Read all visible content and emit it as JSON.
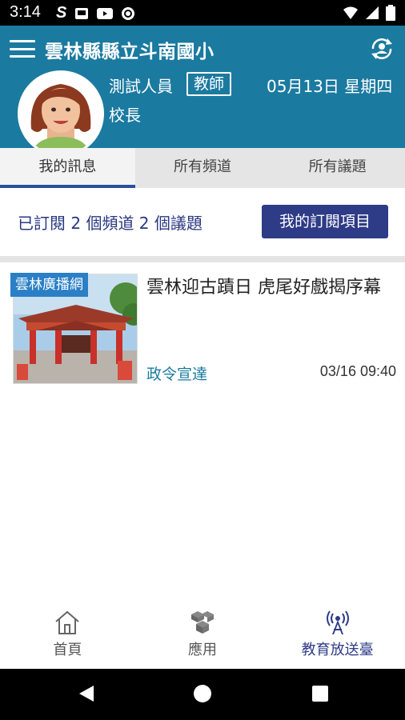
{
  "status_bar": {
    "time": "3:14"
  },
  "header": {
    "title": "雲林縣縣立斗南國小",
    "user_name": "測試人員",
    "role": "教師",
    "date": "05月13日 星期四",
    "user_title": "校長"
  },
  "tabs": [
    {
      "label": "我的訊息",
      "active": true
    },
    {
      "label": "所有頻道",
      "active": false
    },
    {
      "label": "所有議題",
      "active": false
    }
  ],
  "subscription": {
    "summary": "已訂閱 2 個頻道 2 個議題",
    "button_label": "我的訂閱項目"
  },
  "news": [
    {
      "channel": "雲林廣播網",
      "title": "雲林迎古蹟日 虎尾好戲揭序幕",
      "category": "政令宣達",
      "time": "03/16 09:40"
    }
  ],
  "bottom_nav": [
    {
      "label": "首頁",
      "icon": "home-icon",
      "active": false
    },
    {
      "label": "應用",
      "icon": "apps-cubes-icon",
      "active": false
    },
    {
      "label": "教育放送臺",
      "icon": "broadcast-icon",
      "active": true
    }
  ],
  "colors": {
    "header_bg": "#1b7aa0",
    "accent": "#2e3b86",
    "channel_badge": "#2a7fc6",
    "category_text": "#1b7aa0"
  }
}
